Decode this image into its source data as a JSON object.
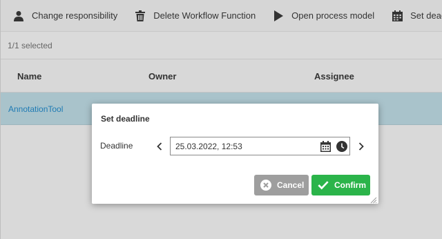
{
  "toolbar": {
    "change_responsibility": "Change responsibility",
    "delete_workflow_function": "Delete Workflow Function",
    "open_process_model": "Open process model",
    "set_deadline": "Set deadline"
  },
  "selection": {
    "text": "1/1 selected"
  },
  "table": {
    "columns": [
      "Name",
      "Owner",
      "Assignee"
    ],
    "rows": [
      {
        "name": "AnnotationTool"
      }
    ]
  },
  "dialog": {
    "title": "Set deadline",
    "field_label": "Deadline",
    "value": "25.03.2022, 12:53",
    "cancel_label": "Cancel",
    "confirm_label": "Confirm"
  },
  "colors": {
    "row_selected": "#a9c3cb",
    "link": "#1f7bb4",
    "confirm": "#2bb44a",
    "cancel": "#9e9e9e"
  }
}
